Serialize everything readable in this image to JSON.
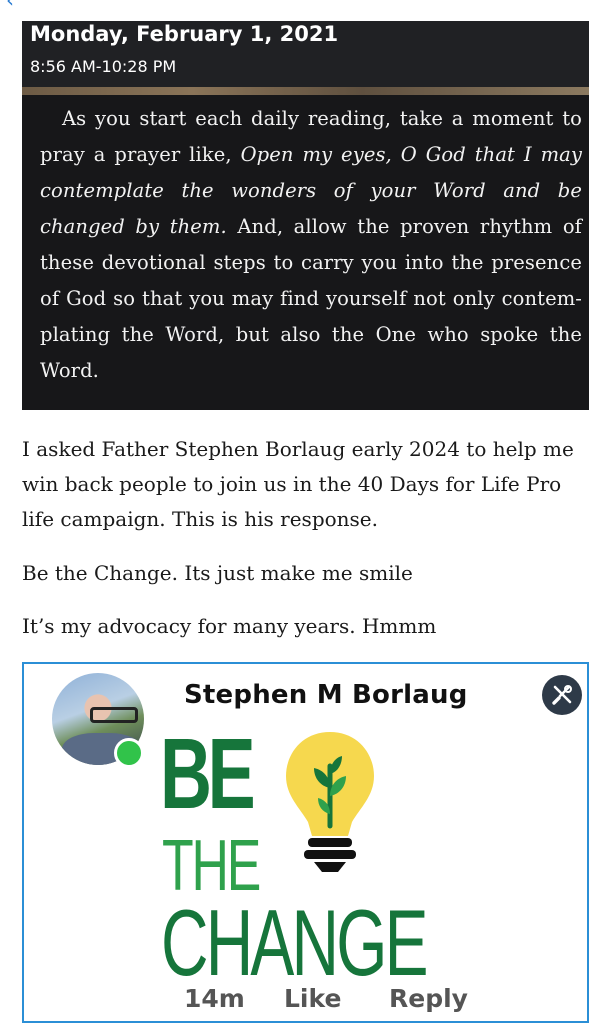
{
  "devotional": {
    "date": "Monday, February 1, 2021",
    "time": "8:56 AM-10:28 PM",
    "text_pre": "As you start each daily reading, take a moment to pray a prayer like, ",
    "text_italic": "Open my eyes, O God that I may contemplate the wonders of your Word and be changed by them.",
    "text_post": " And, allow the proven rhythm of these devotional steps to carry you into the presence of God so that you may find yourself not only contem-plating the Word, but also the One who spoke the Word."
  },
  "post": {
    "paragraphs": [
      "I asked Father Stephen Borlaug early 2024 to help me win back people to join us in the 40 Days for Life Pro life campaign. This is his response.",
      "Be the Change. Its just make me smile",
      "It’s my advocacy for many years. Hmmm"
    ]
  },
  "comment": {
    "author": "Stephen M Borlaug",
    "graphic": {
      "line1": "BE",
      "line2": "THE",
      "line3": "CHANGE"
    },
    "time": "14m",
    "like_label": "Like",
    "reply_label": "Reply",
    "online": true
  },
  "icons": {
    "tools": "tools-icon",
    "avatar": "avatar",
    "bulb": "lightbulb-icon"
  },
  "colors": {
    "link_blue": "#2b8fd6",
    "dark_green": "#16753b",
    "light_green": "#2fa14c",
    "bulb_yellow": "#f6d84e",
    "online_green": "#31c34a"
  }
}
